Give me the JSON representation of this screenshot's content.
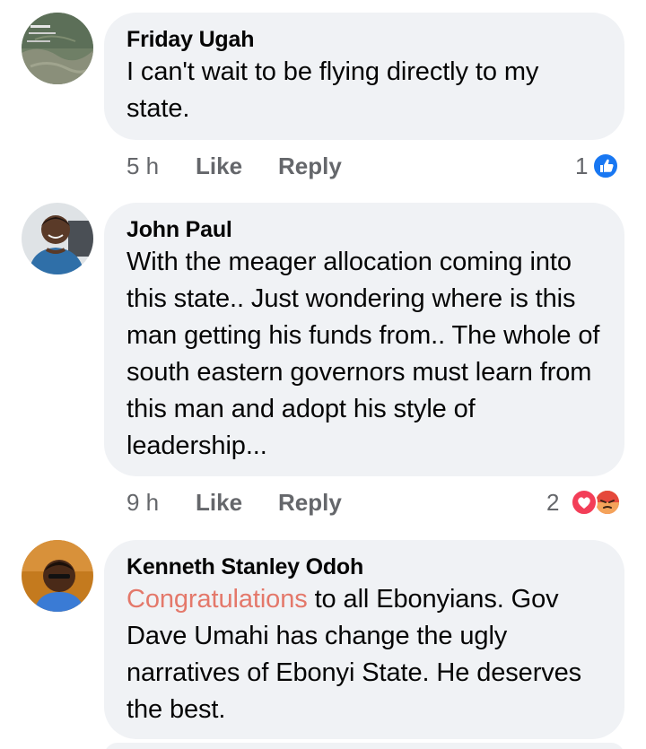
{
  "comments": [
    {
      "author": "Friday Ugah",
      "text": "I can't wait to be flying directly to my state.",
      "time": "5 h",
      "like_label": "Like",
      "reply_label": "Reply",
      "reaction_count": "1",
      "reactions": [
        "like-icon"
      ]
    },
    {
      "author": "John Paul",
      "text": "With the meager allocation coming into this state.. Just wondering where is this man getting his funds from.. The whole of south eastern governors must learn from this man and adopt his style of leadership...",
      "time": "9 h",
      "like_label": "Like",
      "reply_label": "Reply",
      "reaction_count": "2",
      "reactions": [
        "love-icon",
        "angry-icon"
      ]
    },
    {
      "author": "Kenneth Stanley Odoh",
      "highlight": "Congratulations",
      "text": " to all Ebonyians. Gov Dave Umahi has change the ugly narratives of Ebonyi State. He deserves the best."
    }
  ],
  "colors": {
    "bubble": "#f0f2f5",
    "meta_text": "#65676b",
    "like_blue": "#1877f2",
    "love_red": "#f33e58",
    "angry_orange": "#f7714c",
    "highlight": "#e4786a"
  }
}
